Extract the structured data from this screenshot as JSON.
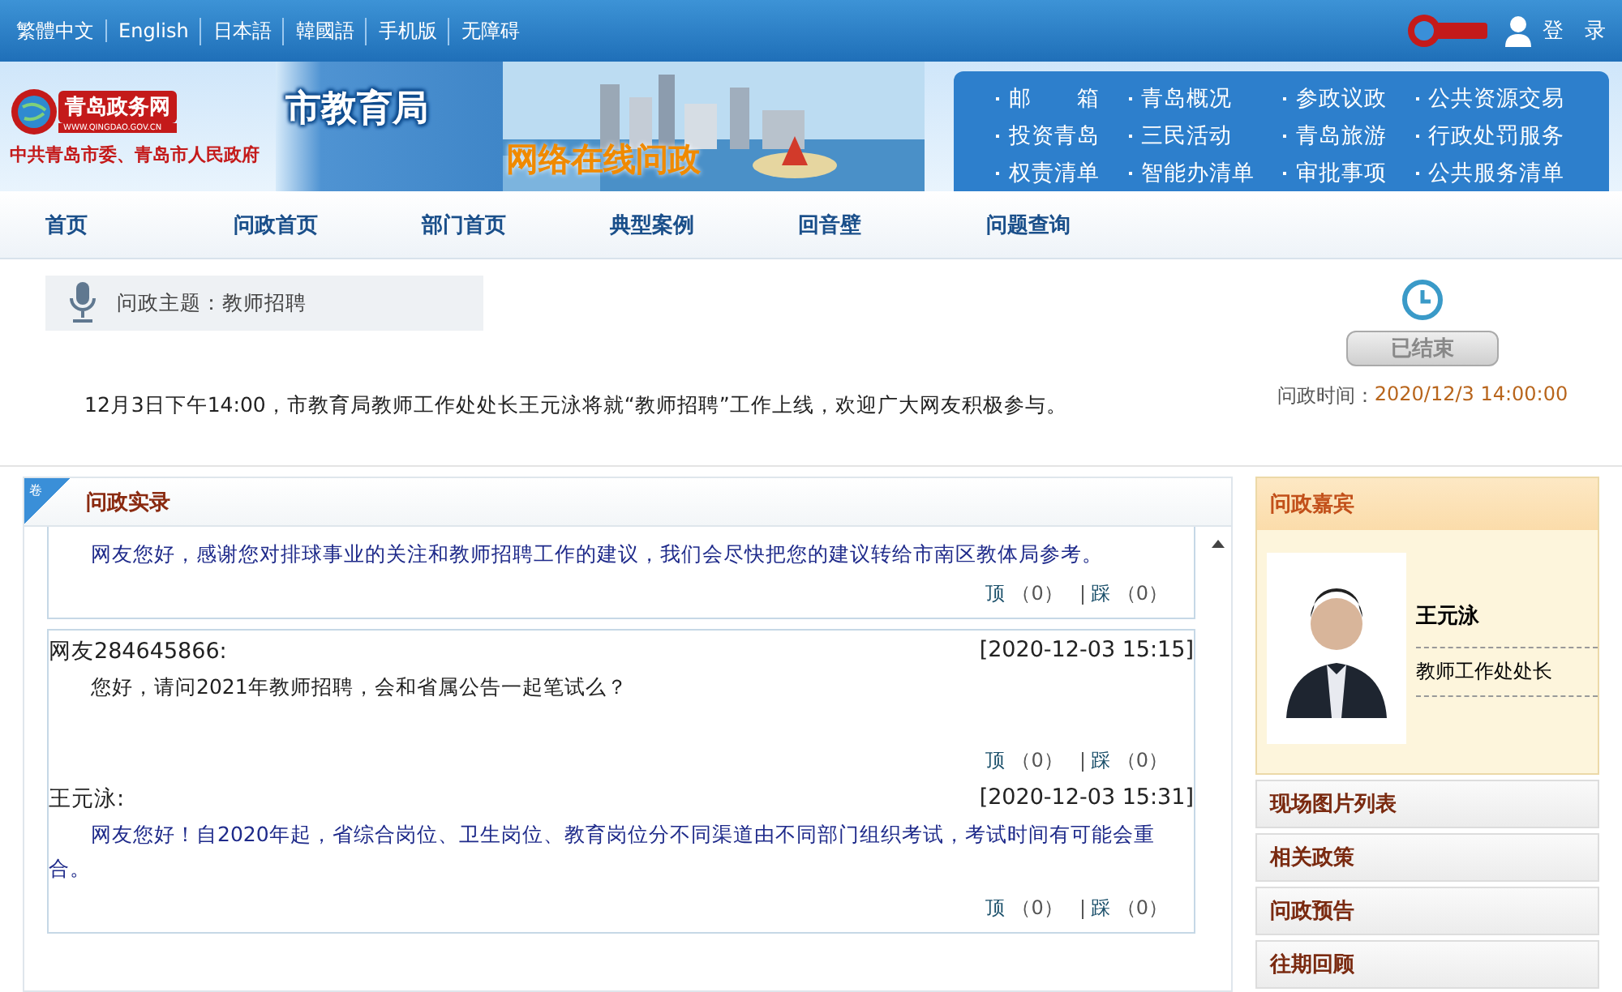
{
  "top_links": [
    "繁體中文",
    "English",
    "日本語",
    "韓國語",
    "手机版",
    "无障碍"
  ],
  "login": "登　录",
  "logo": {
    "name": "青岛政务网",
    "url": "WWW.QINGDAO.GOV.CN",
    "owner": "中共青岛市委、青岛市人民政府"
  },
  "department": "市教育局",
  "banner_title": "网络在线问政",
  "quick_links": [
    "邮　　箱",
    "青岛概况",
    "参政议政",
    "公共资源交易",
    "投资青岛",
    "三民活动",
    "青岛旅游",
    "行政处罚服务",
    "权责清单",
    "智能办清单",
    "审批事项",
    "公共服务清单"
  ],
  "nav": [
    {
      "label": "首页",
      "selected": false
    },
    {
      "label": "问政首页",
      "selected": false
    },
    {
      "label": "部门首页",
      "selected": false
    },
    {
      "label": "典型案例",
      "selected": false
    },
    {
      "label": "回音壁",
      "selected": false
    },
    {
      "label": "问题查询",
      "selected": false
    }
  ],
  "topic": {
    "label": "问政主题：教师招聘",
    "notice": "12月3日下午14:00，市教育局教师工作处处长王元泳将就“教师招聘”工作上线，欢迎广大网友积极参与。"
  },
  "status": {
    "label": "已结束",
    "ended": true,
    "time_label": "问政时间：",
    "time": "2020/12/3 14:00:00"
  },
  "record": {
    "title": "问政实录",
    "badge": "卷",
    "blocks": [
      {
        "messages": [
          {
            "kind": "answer",
            "body": "网友您好，感谢您对排球事业的关注和教师招聘工作的建议，我们会尽快把您的建议转给市南区教体局参考。",
            "up": "顶",
            "up_count": "（0）",
            "down": "踩",
            "down_count": "（0）"
          }
        ]
      },
      {
        "messages": [
          {
            "kind": "question",
            "author": "网友284645866:",
            "time": "[2020-12-03 15:15]",
            "body": "您好，请问2021年教师招聘，会和省属公告一起笔试么？",
            "up": "顶",
            "up_count": "（0）",
            "down": "踩",
            "down_count": "（0）"
          },
          {
            "kind": "answer",
            "author": "王元泳:",
            "time": "[2020-12-03 15:31]",
            "body": "网友您好！自2020年起，省综合岗位、卫生岗位、教育岗位分不同渠道由不同部门组织考试，考试时间有可能会重合。",
            "up": "顶",
            "up_count": "（0）",
            "down": "踩",
            "down_count": "（0）"
          }
        ]
      }
    ]
  },
  "guest": {
    "title": "问政嘉宾",
    "name": "王元泳",
    "position": "教师工作处处长"
  },
  "side_sections": [
    "现场图片列表",
    "相关政策",
    "问政预告",
    "往期回顾"
  ]
}
